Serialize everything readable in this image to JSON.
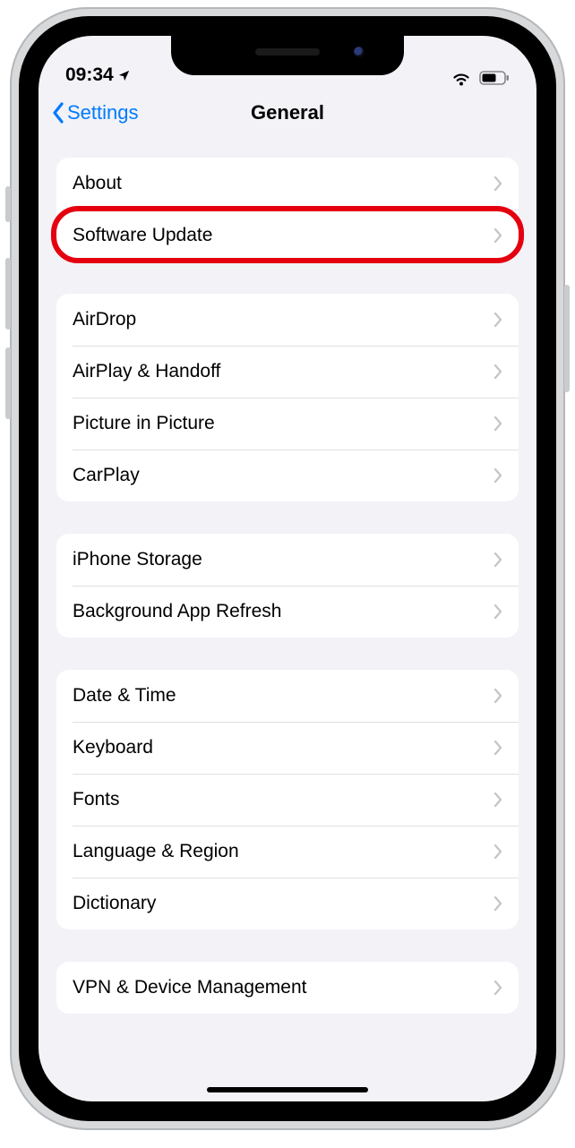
{
  "statusbar": {
    "time": "09:34"
  },
  "navbar": {
    "back_label": "Settings",
    "title": "General"
  },
  "groups": [
    {
      "cells": [
        {
          "label": "About"
        },
        {
          "label": "Software Update",
          "highlighted": true
        }
      ]
    },
    {
      "cells": [
        {
          "label": "AirDrop"
        },
        {
          "label": "AirPlay & Handoff"
        },
        {
          "label": "Picture in Picture"
        },
        {
          "label": "CarPlay"
        }
      ]
    },
    {
      "cells": [
        {
          "label": "iPhone Storage"
        },
        {
          "label": "Background App Refresh"
        }
      ]
    },
    {
      "cells": [
        {
          "label": "Date & Time"
        },
        {
          "label": "Keyboard"
        },
        {
          "label": "Fonts"
        },
        {
          "label": "Language & Region"
        },
        {
          "label": "Dictionary"
        }
      ]
    },
    {
      "cells": [
        {
          "label": "VPN & Device Management"
        }
      ]
    }
  ]
}
